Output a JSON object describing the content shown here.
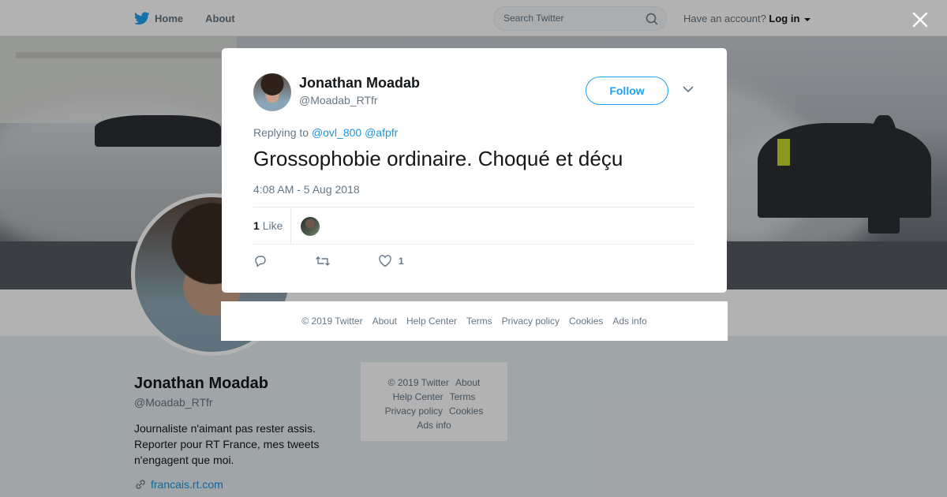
{
  "nav": {
    "home_label": "Home",
    "about_label": "About",
    "search_placeholder": "Search Twitter",
    "account_prompt": "Have an account?",
    "login_label": "Log in"
  },
  "profile": {
    "name": "Jonathan Moadab",
    "handle": "@Moadab_RTfr",
    "bio": "Journaliste n'aimant pas rester assis. Reporter pour RT France, mes tweets n'engagent que moi.",
    "url": "francais.rt.com"
  },
  "side_footer": {
    "copyright": "© 2019 Twitter",
    "about": "About",
    "help": "Help Center",
    "terms": "Terms",
    "privacy": "Privacy policy",
    "cookies": "Cookies",
    "ads": "Ads info"
  },
  "tweet": {
    "author_name": "Jonathan Moadab",
    "author_handle": "@Moadab_RTfr",
    "follow_label": "Follow",
    "replying_prefix": "Replying to",
    "mentions": [
      "@ovl_800",
      "@afpfr"
    ],
    "text": "Grossophobie ordinaire. Choqué et déçu",
    "timestamp": "4:08 AM - 5 Aug 2018",
    "like_count": "1",
    "like_label": "Like",
    "action_like_count": "1"
  },
  "modal_footer": {
    "copyright": "© 2019 Twitter",
    "about": "About",
    "help": "Help Center",
    "terms": "Terms",
    "privacy": "Privacy policy",
    "cookies": "Cookies",
    "ads": "Ads info"
  },
  "colors": {
    "twitter_blue": "#1da1f2",
    "link_blue": "#1b95e0",
    "text_primary": "#14171a",
    "text_secondary": "#657786"
  }
}
